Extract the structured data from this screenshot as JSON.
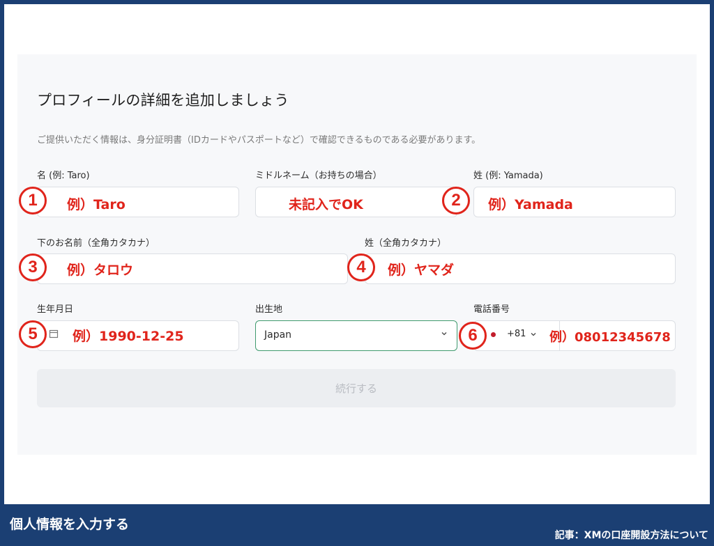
{
  "form": {
    "title": "プロフィールの詳細を追加しましょう",
    "description": "ご提供いただく情報は、身分証明書（IDカードやパスポートなど）で確認できるものである必要があります。",
    "first_name_label": "名 (例: Taro)",
    "middle_name_label": "ミドルネーム（お持ちの場合）",
    "last_name_label": "姓 (例: Yamada)",
    "first_kana_label": "下のお名前（全角カタカナ）",
    "last_kana_label": "姓（全角カタカナ）",
    "birthdate_label": "生年月日",
    "birthplace_label": "出生地",
    "phone_label": "電話番号",
    "birthplace_value": "Japan",
    "dial_code": "+81",
    "continue_label": "続行する"
  },
  "annotations": {
    "first_name_example": "例）Taro",
    "middle_name_example": "未記入でOK",
    "last_name_example": "例）Yamada",
    "first_kana_example": "例）タロウ",
    "last_kana_example": "例）ヤマダ",
    "birthdate_example": "例）1990-12-25",
    "phone_example": "例）08012345678",
    "numbers": [
      "1",
      "2",
      "3",
      "4",
      "5",
      "6"
    ]
  },
  "footer": {
    "left": "個人情報を入力する",
    "right": "記事：XMの口座開設方法について"
  },
  "colors": {
    "frame": "#1b3f73",
    "annotation_red": "#e0241b",
    "select_border": "#3f9a6e"
  },
  "icons": [
    "calendar-icon",
    "chevron-down-icon"
  ]
}
